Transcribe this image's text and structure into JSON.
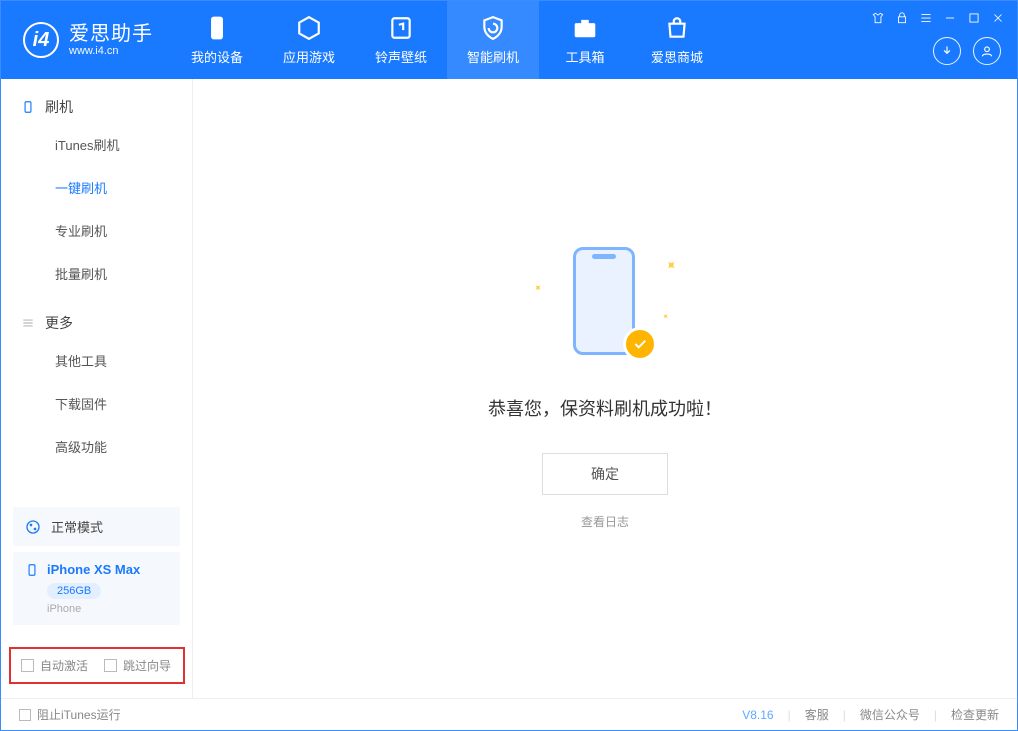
{
  "logo": {
    "title": "爱思助手",
    "subtitle": "www.i4.cn"
  },
  "nav": {
    "device": "我的设备",
    "apps": "应用游戏",
    "ring": "铃声壁纸",
    "flash": "智能刷机",
    "tools": "工具箱",
    "store": "爱思商城"
  },
  "sidebar": {
    "section1": {
      "title": "刷机",
      "items": {
        "itunes": "iTunes刷机",
        "onekey": "一键刷机",
        "pro": "专业刷机",
        "batch": "批量刷机"
      }
    },
    "section2": {
      "title": "更多",
      "items": {
        "other": "其他工具",
        "firmware": "下载固件",
        "advanced": "高级功能"
      }
    }
  },
  "device": {
    "mode": "正常模式",
    "name": "iPhone XS Max",
    "storage": "256GB",
    "type": "iPhone"
  },
  "options": {
    "auto_activate": "自动激活",
    "skip_guide": "跳过向导"
  },
  "main": {
    "message": "恭喜您，保资料刷机成功啦！",
    "ok": "确定",
    "view_log": "查看日志"
  },
  "footer": {
    "block_itunes": "阻止iTunes运行",
    "version": "V8.16",
    "support": "客服",
    "wechat": "微信公众号",
    "update": "检查更新"
  }
}
